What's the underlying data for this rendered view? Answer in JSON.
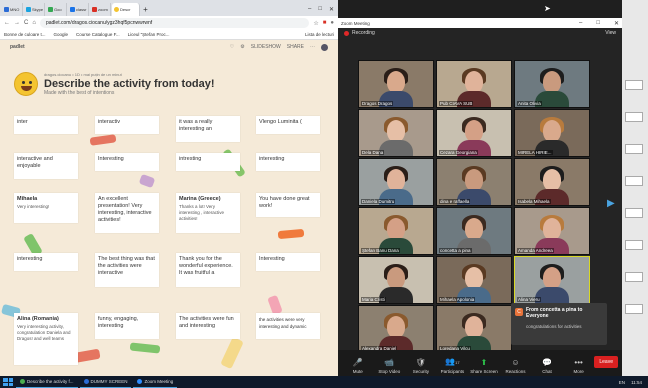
{
  "browser": {
    "tabs": [
      {
        "label": "MNO",
        "color": "#2b6cd6"
      },
      {
        "label": "Skype",
        "color": "#1aa3e0"
      },
      {
        "label": "Goo",
        "color": "#34a853"
      },
      {
        "label": "classr",
        "color": "#1a73e8"
      },
      {
        "label": "zoom",
        "color": "#d93025"
      }
    ],
    "active_tab": "Descr",
    "new_tab": "+",
    "url": "padlet.com/dragos.ciocanu/ygz3hqf5pcnwwrwnf",
    "nav": [
      "←",
      "→",
      "C",
      "⌂"
    ],
    "bookmarks": [
      "Bonne de culoare t...",
      "Google",
      "Course Catalogue F...",
      "Liceul \"Ștefan Proc..."
    ],
    "bookmarks_right": "Lista de lecturi"
  },
  "padlet": {
    "logo": "padlet",
    "header_right": [
      "SLIDESHOW",
      "SHARE"
    ],
    "meta": "dragos.ciocanu • 1D • mai puțin de un minut",
    "title": "Describe the activity from today!",
    "subtitle": "Made with the best of intentions",
    "cards": [
      {
        "title": "inter",
        "body": ""
      },
      {
        "title": "interactiv",
        "body": ""
      },
      {
        "title": "it was a really interesting an",
        "body": ""
      },
      {
        "title": "Vlengo Luminita (",
        "body": ""
      },
      {
        "title": "interactive and enjoyable",
        "body": ""
      },
      {
        "title": "Interesting",
        "body": ""
      },
      {
        "title": "intresting",
        "body": ""
      },
      {
        "title": "interesting",
        "body": ""
      },
      {
        "title": "Mihaela",
        "body": "Very interesting!"
      },
      {
        "title": "An excellent presentation! Very interesting, interactive activities!",
        "body": ""
      },
      {
        "title": "Marina (Greece)",
        "body": "Thanks a lot! Very interesting , interactive activities!"
      },
      {
        "title": "You have done great work!",
        "body": ""
      },
      {
        "title": "interesting",
        "body": ""
      },
      {
        "title": "The best thing was that the activities were interactive",
        "body": ""
      },
      {
        "title": "Thank you for the wonderful experience. It was fruitful a",
        "body": ""
      },
      {
        "title": "Interesting",
        "body": ""
      },
      {
        "title": "Alina (Romania)",
        "body": "Very interesting activity, congratulation Daniela and Dragos! and well teams"
      },
      {
        "title": "funny, engaging, interesting",
        "body": ""
      },
      {
        "title": "The activities were fun and interesting",
        "body": ""
      },
      {
        "title": "the activities were very interesting and dynamic",
        "body": ""
      }
    ],
    "fab": "+"
  },
  "zoom": {
    "window_title": "Zoom Meeting",
    "recording": "Recording",
    "view": "View",
    "participants": [
      {
        "name": "Dragos Dragos"
      },
      {
        "name": "Pub CIAVA SUB"
      },
      {
        "name": "Anita Olivia"
      },
      {
        "name": "Dela Dana"
      },
      {
        "name": "Cezara Georgiana"
      },
      {
        "name": "MIRELA HIRIE..."
      },
      {
        "name": "Daniela Dumitru"
      },
      {
        "name": "dina e raffaella"
      },
      {
        "name": "Isabela Mihaela"
      },
      {
        "name": "Ștefan Banu Dana"
      },
      {
        "name": "concetta a pina"
      },
      {
        "name": "Amanda Andreea"
      },
      {
        "name": "Maria Cristi"
      },
      {
        "name": "Mihaela Apolonia"
      },
      {
        "name": "Alina Vieru"
      },
      {
        "name": "Alexandra Daniel"
      },
      {
        "name": "Loredana Vilcu"
      }
    ],
    "chat": {
      "initial": "C",
      "from": "From concetta a pina to Everyone",
      "message": "congratulations for activities"
    },
    "toolbar": [
      {
        "label": "Mute",
        "icon": "🎤"
      },
      {
        "label": "Stop Video",
        "icon": "📹"
      },
      {
        "label": "Security",
        "icon": "🛡"
      },
      {
        "label": "Participants",
        "icon": "👥"
      },
      {
        "label": "Share Screen",
        "icon": "⬆"
      },
      {
        "label": "Reactions",
        "icon": "☺"
      },
      {
        "label": "Chat",
        "icon": "💬"
      },
      {
        "label": "More",
        "icon": "•••"
      }
    ],
    "end": "Leave",
    "participant_count": "17"
  },
  "taskbar": {
    "items": [
      "Describe the activity f...",
      "DUMMY SCREEN",
      "Zoom Meeting"
    ],
    "tray": [
      "EN",
      "11:54"
    ]
  }
}
